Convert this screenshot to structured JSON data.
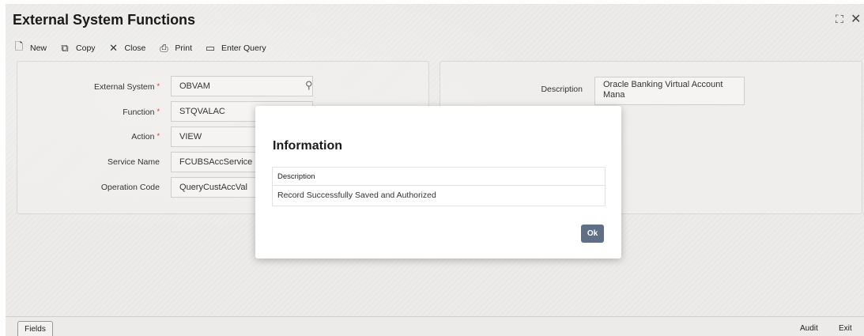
{
  "window": {
    "title": "External System Functions",
    "maximize_icon": "maximize-icon",
    "close_icon": "close-icon"
  },
  "toolbar": {
    "new_label": "New",
    "copy_label": "Copy",
    "close_label": "Close",
    "print_label": "Print",
    "enter_query_label": "Enter Query"
  },
  "form": {
    "external_system_label": "External System",
    "external_system_value": "OBVAM",
    "function_label": "Function",
    "function_value": "STQVALAC",
    "action_label": "Action",
    "action_value": "VIEW",
    "service_name_label": "Service Name",
    "service_name_value": "FCUBSAccService",
    "operation_code_label": "Operation Code",
    "operation_code_value": "QueryCustAccVal",
    "required_marker": "*",
    "description_label": "Description",
    "description_value": "Oracle Banking Virtual Account Mana"
  },
  "dialog": {
    "title": "Information",
    "column_header": "Description",
    "message": "Record Successfully Saved and Authorized",
    "ok_label": "Ok"
  },
  "footer": {
    "fields_label": "Fields",
    "audit_label": "Audit",
    "exit_label": "Exit"
  }
}
